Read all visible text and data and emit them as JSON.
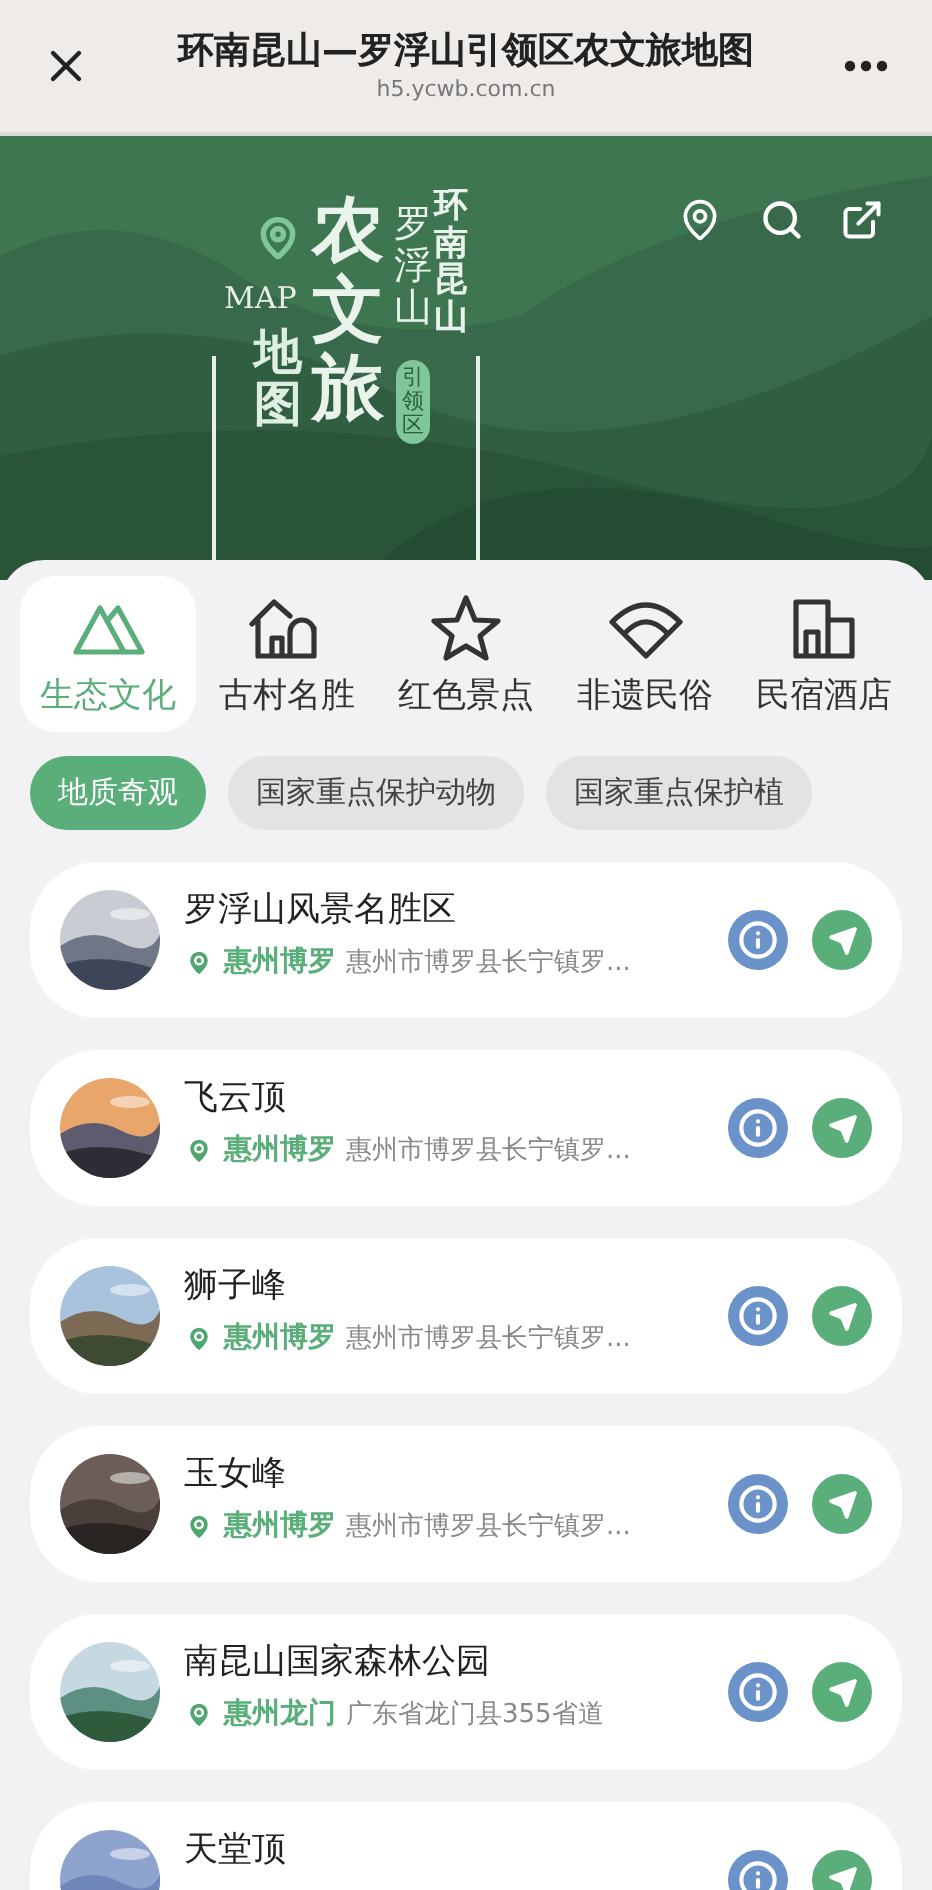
{
  "header": {
    "title": "环南昆山—罗浮山引领区农文旅地图",
    "url": "h5.ycwb.com.cn"
  },
  "banner": {
    "logo": {
      "map": "MAP",
      "ditu": "地图",
      "main": "农文旅",
      "region_1": "环南昆山",
      "region_2": "罗浮山",
      "badge": "引领区"
    }
  },
  "categories": [
    {
      "label": "生态文化",
      "selected": true,
      "kind": "mountain"
    },
    {
      "label": "古村名胜",
      "selected": false,
      "kind": "village"
    },
    {
      "label": "红色景点",
      "selected": false,
      "kind": "star"
    },
    {
      "label": "非遗民俗",
      "selected": false,
      "kind": "fan"
    },
    {
      "label": "民宿酒店",
      "selected": false,
      "kind": "hotel"
    }
  ],
  "chips": [
    {
      "label": "地质奇观",
      "selected": true
    },
    {
      "label": "国家重点保护动物",
      "selected": false
    },
    {
      "label": "国家重点保护植",
      "selected": false
    }
  ],
  "places": [
    {
      "name": "罗浮山风景名胜区",
      "city": "惠州博罗",
      "address": "惠州市博罗县长宁镇罗..."
    },
    {
      "name": "飞云顶",
      "city": "惠州博罗",
      "address": "惠州市博罗县长宁镇罗..."
    },
    {
      "name": "狮子峰",
      "city": "惠州博罗",
      "address": "惠州市博罗县长宁镇罗..."
    },
    {
      "name": "玉女峰",
      "city": "惠州博罗",
      "address": "惠州市博罗县长宁镇罗..."
    },
    {
      "name": "南昆山国家森林公园",
      "city": "惠州龙门",
      "address": "广东省龙门县355省道"
    },
    {
      "name": "天堂顶"
    }
  ]
}
